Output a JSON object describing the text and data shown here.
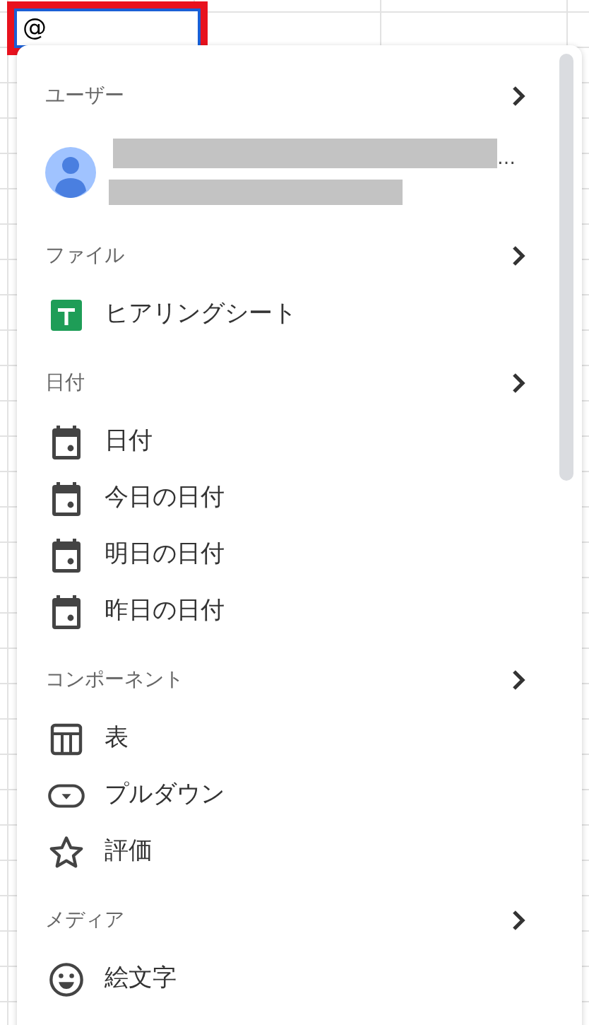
{
  "cell": {
    "value": "@"
  },
  "sections": [
    {
      "title": "ユーザー",
      "items": [
        {
          "kind": "user",
          "ellipsis": "…"
        }
      ]
    },
    {
      "title": "ファイル",
      "items": [
        {
          "kind": "sheet",
          "label": "ヒアリングシート"
        }
      ]
    },
    {
      "title": "日付",
      "items": [
        {
          "kind": "calendar",
          "label": "日付"
        },
        {
          "kind": "calendar",
          "label": "今日の日付"
        },
        {
          "kind": "calendar",
          "label": "明日の日付"
        },
        {
          "kind": "calendar",
          "label": "昨日の日付"
        }
      ]
    },
    {
      "title": "コンポーネント",
      "items": [
        {
          "kind": "table",
          "label": "表"
        },
        {
          "kind": "dropdown",
          "label": "プルダウン"
        },
        {
          "kind": "star",
          "label": "評価"
        }
      ]
    },
    {
      "title": "メディア",
      "items": [
        {
          "kind": "emoji",
          "label": "絵文字"
        }
      ]
    }
  ]
}
